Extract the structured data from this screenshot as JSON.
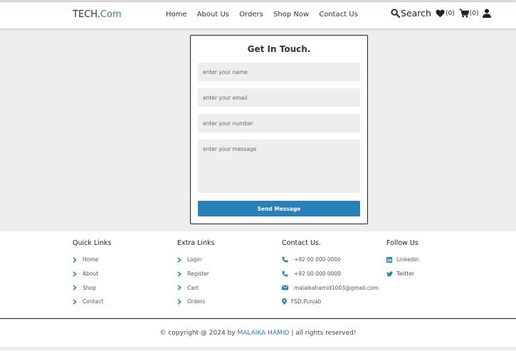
{
  "header": {
    "logo_main": "TECH.",
    "logo_accent": "Com",
    "nav": [
      "Home",
      "About Us",
      "Orders",
      "Shop Now",
      "Contact Us"
    ],
    "search_label": "Search",
    "wishlist_count": "(0)",
    "cart_count": "(0)"
  },
  "form": {
    "title": "Get In Touch.",
    "name_placeholder": "enter your name",
    "email_placeholder": "enter your email",
    "number_placeholder": "enter your number",
    "message_placeholder": "enter your message",
    "submit_label": "Send Message"
  },
  "footer": {
    "quick_links": {
      "title": "Quick Links",
      "items": [
        "Home",
        "About",
        "Shop",
        "Contact"
      ]
    },
    "extra_links": {
      "title": "Extra Links",
      "items": [
        "Login",
        "Register",
        "Cart",
        "Orders"
      ]
    },
    "contact": {
      "title": "Contact Us.",
      "phone1": "+92 00 000 0000",
      "phone2": "+92 00 000 0000",
      "email": "malaikahamid1003@gmail.com",
      "location": "FSD,Punjab"
    },
    "follow": {
      "title": "Follow Us",
      "items": [
        "Linkedin",
        "Twitter"
      ]
    },
    "copyright_prefix": "© copyright @ 2024 by",
    "author": "MALAIKA HAMID",
    "copyright_suffix": "| all rights reserved!"
  },
  "colors": {
    "accent": "#2980b9",
    "background": "#eeeeee"
  }
}
